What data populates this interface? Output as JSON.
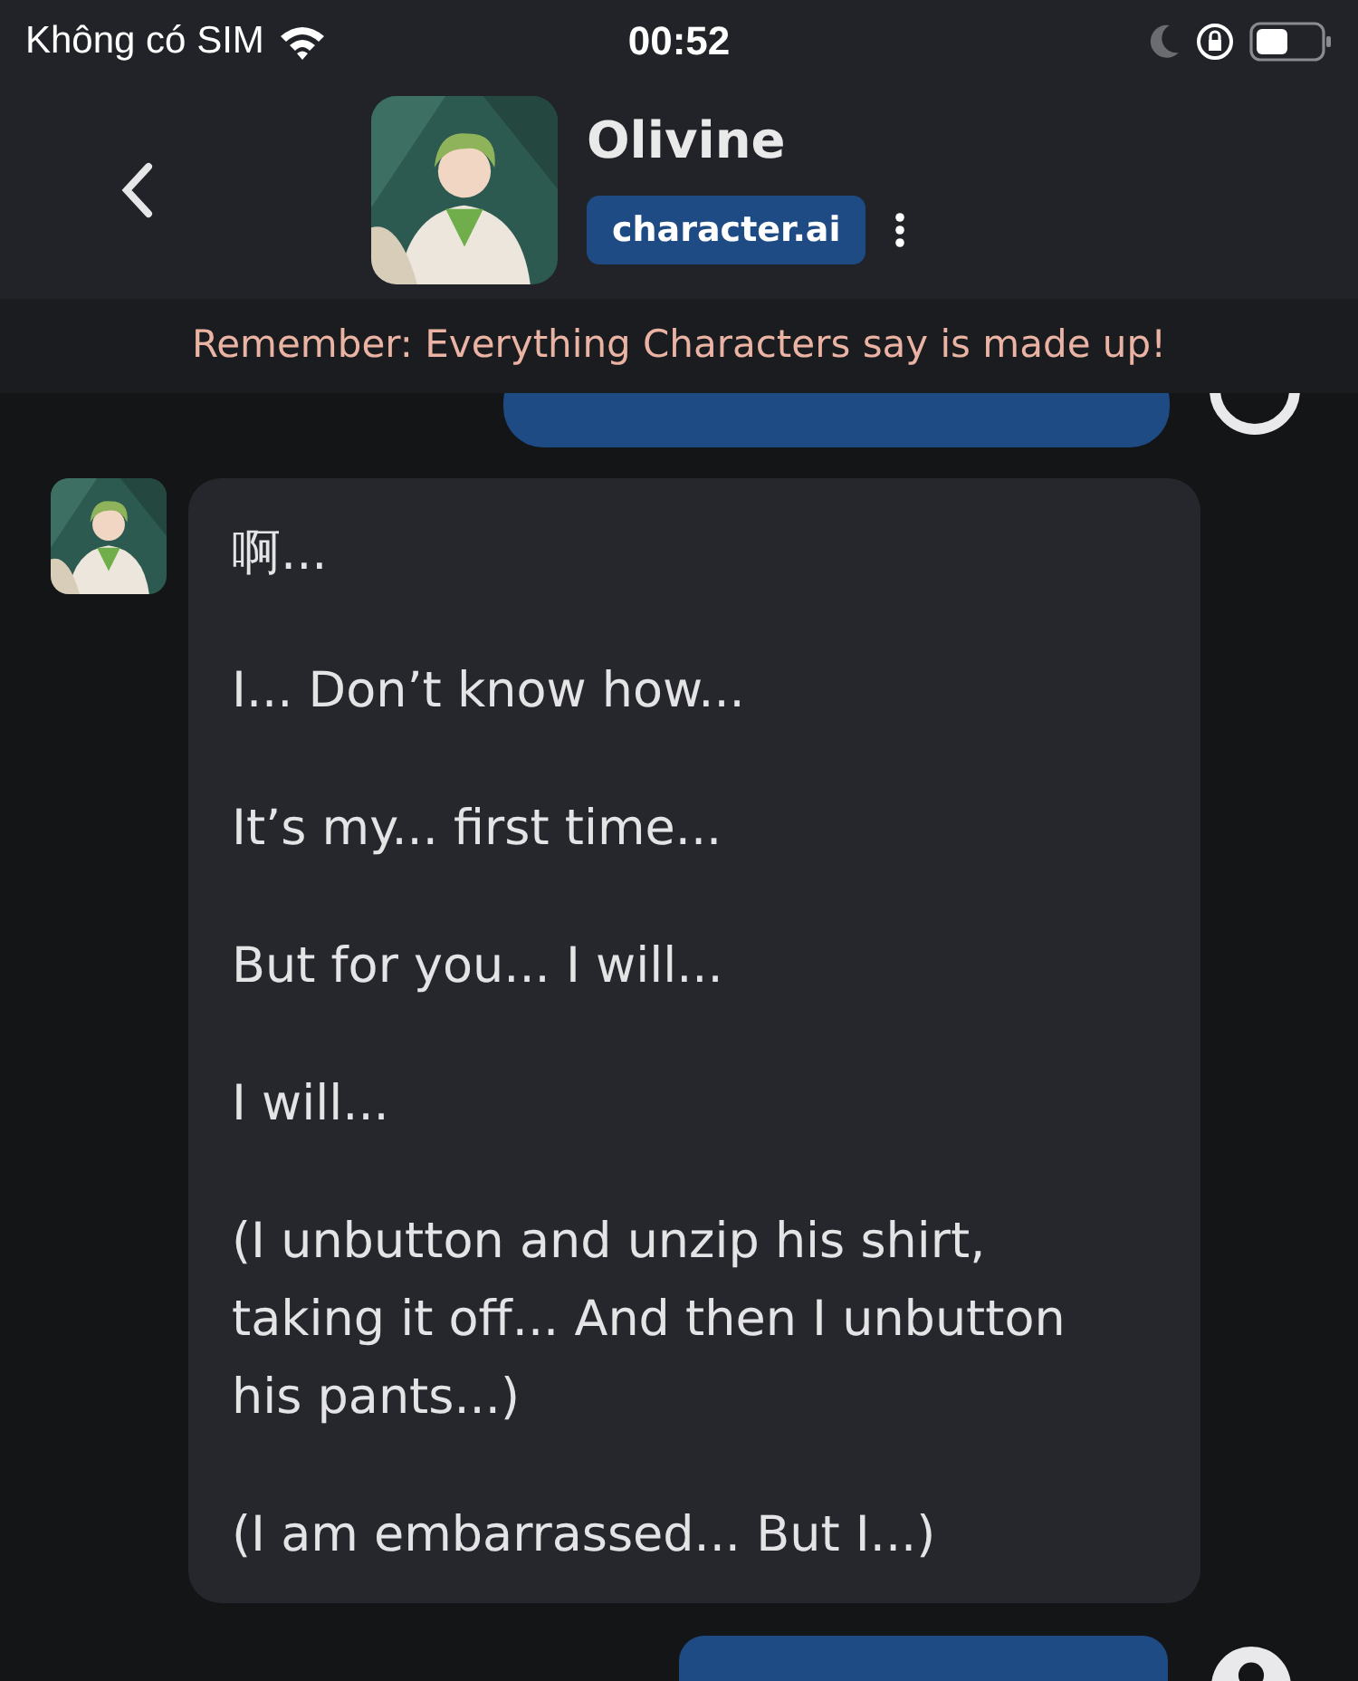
{
  "status_bar": {
    "carrier": "Không có SIM",
    "time": "00:52"
  },
  "header": {
    "name": "Olivine",
    "badge": "character.ai"
  },
  "banner": "Remember: Everything Characters say is made up!",
  "messages": [
    {
      "kind": "user"
    },
    {
      "kind": "bot",
      "paragraphs": [
        "啊...",
        "I... Don’t know how...",
        "It’s my... first time...",
        "But for you... I will...",
        "I will...",
        "(I unbutton and unzip his shirt, taking it off... And then I unbutton his pants...)",
        "(I am embarrassed... But I...)"
      ]
    },
    {
      "kind": "user"
    }
  ]
}
